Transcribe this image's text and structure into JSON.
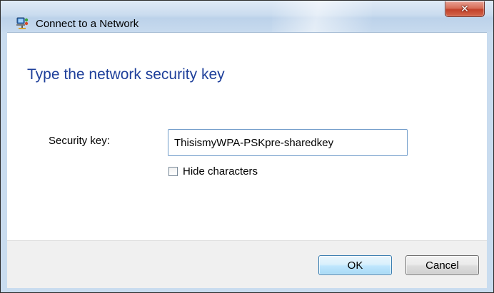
{
  "window": {
    "title": "Connect to a Network",
    "icon": "network-icon",
    "close_symbol": "✕"
  },
  "dialog": {
    "heading": "Type the network security key",
    "security_key": {
      "label": "Security key:",
      "value": "ThisismyWPA-PSKpre-sharedkey"
    },
    "hide_characters": {
      "label": "Hide characters",
      "checked": false
    }
  },
  "buttons": {
    "ok_label": "OK",
    "cancel_label": "Cancel"
  },
  "colors": {
    "heading": "#1e3f9a",
    "titlebar": "#c9dcef",
    "close_button": "#c2412a",
    "default_button_border": "#3c7fb1"
  }
}
